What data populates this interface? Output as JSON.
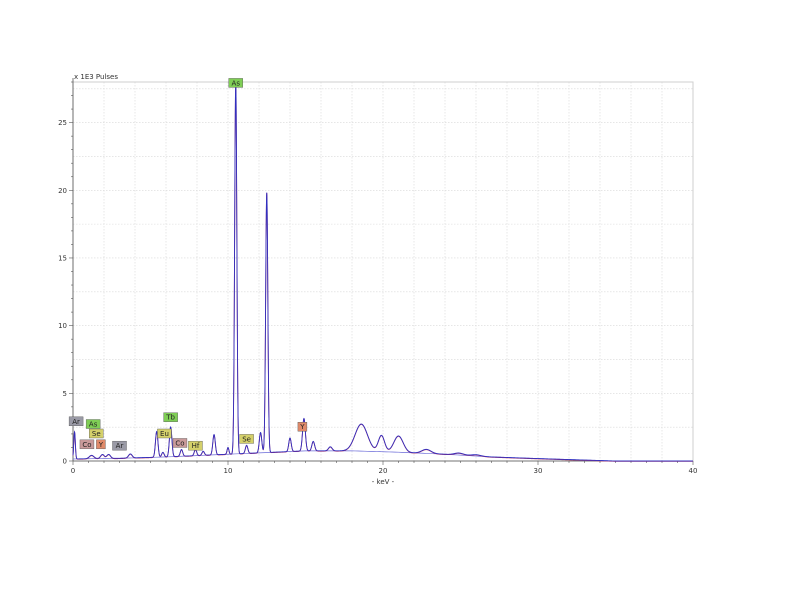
{
  "chart_data": {
    "type": "line",
    "ylabel": "x 1E3 Pulses",
    "xlabel": "- keV -",
    "xlim": [
      0,
      40
    ],
    "ylim": [
      0,
      28
    ],
    "grid": true,
    "x_ticks": [
      0,
      10,
      20,
      30,
      40
    ],
    "y_ticks": [
      0,
      5,
      10,
      15,
      20,
      25
    ],
    "series": [
      {
        "color": "#3030c0",
        "peaks": [
          {
            "x": 0.1,
            "y": 2.0,
            "w": 0.05
          },
          {
            "x": 1.2,
            "y": 0.25,
            "w": 0.15
          },
          {
            "x": 1.9,
            "y": 0.3,
            "w": 0.12
          },
          {
            "x": 2.3,
            "y": 0.3,
            "w": 0.12
          },
          {
            "x": 3.7,
            "y": 0.3,
            "w": 0.12
          },
          {
            "x": 5.4,
            "y": 1.9,
            "w": 0.08
          },
          {
            "x": 5.8,
            "y": 0.35,
            "w": 0.08
          },
          {
            "x": 6.3,
            "y": 2.2,
            "w": 0.08
          },
          {
            "x": 7.0,
            "y": 0.5,
            "w": 0.08
          },
          {
            "x": 7.9,
            "y": 0.45,
            "w": 0.08
          },
          {
            "x": 8.4,
            "y": 0.3,
            "w": 0.08
          },
          {
            "x": 9.1,
            "y": 1.5,
            "w": 0.08
          },
          {
            "x": 10.0,
            "y": 0.5,
            "w": 0.06
          },
          {
            "x": 10.5,
            "y": 27.5,
            "w": 0.07
          },
          {
            "x": 11.2,
            "y": 0.6,
            "w": 0.08
          },
          {
            "x": 12.1,
            "y": 1.5,
            "w": 0.08
          },
          {
            "x": 12.5,
            "y": 19.2,
            "w": 0.07
          },
          {
            "x": 14.0,
            "y": 1.0,
            "w": 0.08
          },
          {
            "x": 14.9,
            "y": 2.4,
            "w": 0.09
          },
          {
            "x": 15.5,
            "y": 0.7,
            "w": 0.09
          },
          {
            "x": 16.6,
            "y": 0.3,
            "w": 0.12
          },
          {
            "x": 18.6,
            "y": 2.0,
            "w": 0.4
          },
          {
            "x": 19.9,
            "y": 1.2,
            "w": 0.2
          },
          {
            "x": 21.0,
            "y": 1.2,
            "w": 0.3
          },
          {
            "x": 22.8,
            "y": 0.3,
            "w": 0.3
          },
          {
            "x": 24.9,
            "y": 0.15,
            "w": 0.3
          },
          {
            "x": 26.0,
            "y": 0.1,
            "w": 0.3
          }
        ],
        "background": [
          [
            0,
            0.15
          ],
          [
            3,
            0.2
          ],
          [
            6,
            0.3
          ],
          [
            9,
            0.45
          ],
          [
            12,
            0.6
          ],
          [
            15,
            0.75
          ],
          [
            18,
            0.75
          ],
          [
            21,
            0.65
          ],
          [
            24,
            0.5
          ],
          [
            27,
            0.3
          ],
          [
            30,
            0.18
          ],
          [
            33,
            0.07
          ],
          [
            35,
            0.0
          ],
          [
            40,
            0.0
          ]
        ]
      },
      {
        "color": "#c0305a",
        "peaks_ref": "series.0"
      }
    ],
    "annotations": [
      {
        "text": "As",
        "x": 10.5,
        "y": 27.6,
        "color": "#7fce55"
      },
      {
        "text": "Tb",
        "x": 6.3,
        "y": 2.9,
        "color": "#7fce55"
      },
      {
        "text": "Eu",
        "x": 5.9,
        "y": 1.7,
        "color": "#d4d06a"
      },
      {
        "text": "Co",
        "x": 6.9,
        "y": 1.0,
        "color": "#c99a9a"
      },
      {
        "text": "Hf",
        "x": 7.9,
        "y": 0.8,
        "color": "#d4d06a"
      },
      {
        "text": "Se",
        "x": 11.2,
        "y": 1.3,
        "color": "#d4d06a"
      },
      {
        "text": "Y",
        "x": 14.8,
        "y": 2.2,
        "color": "#e08a6a"
      },
      {
        "text": "Ar",
        "x": 0.2,
        "y": 2.6,
        "color": "#9a9aa6"
      },
      {
        "text": "As",
        "x": 1.3,
        "y": 2.4,
        "color": "#7fce55"
      },
      {
        "text": "Se",
        "x": 1.5,
        "y": 1.7,
        "color": "#d4d06a"
      },
      {
        "text": "Co",
        "x": 0.9,
        "y": 0.9,
        "color": "#c99a9a"
      },
      {
        "text": "Y",
        "x": 1.8,
        "y": 0.9,
        "color": "#e08a6a"
      },
      {
        "text": "Ar",
        "x": 3.0,
        "y": 0.8,
        "color": "#9a9aa6"
      }
    ]
  }
}
